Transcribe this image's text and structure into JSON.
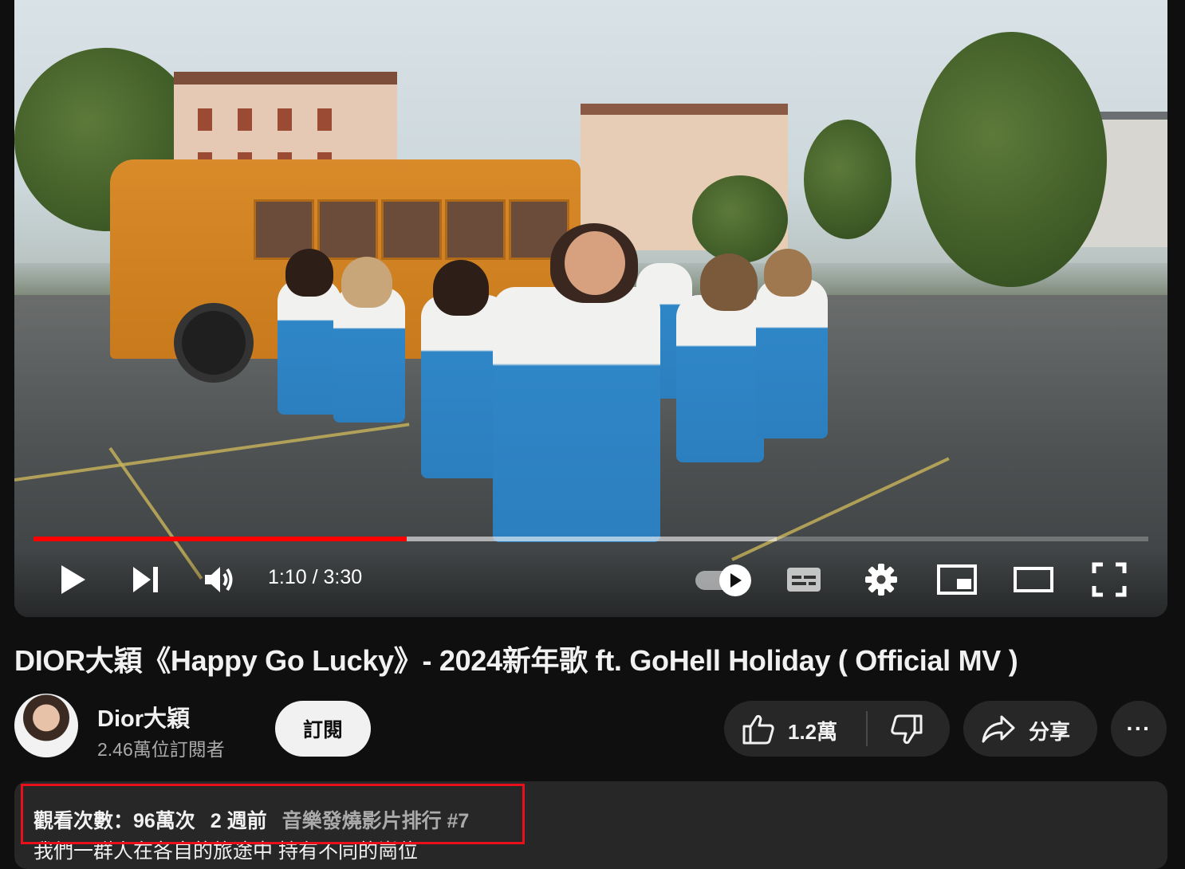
{
  "player": {
    "time_display": "1:10 / 3:30",
    "progress_played": 0.335,
    "progress_buffered": 0.667,
    "autoplay_on": true
  },
  "video": {
    "title": "DIOR大穎《Happy Go Lucky》- 2024新年歌 ft. GoHell Holiday ( Official MV )"
  },
  "channel": {
    "name": "Dior大穎",
    "subscribers": "2.46萬位訂閱者",
    "subscribe_label": "訂閱"
  },
  "actions": {
    "like_count": "1.2萬",
    "share_label": "分享",
    "more_label": "···"
  },
  "description": {
    "views": "觀看次數：96萬次",
    "date": "2 週前",
    "trending": "音樂發燒影片排行 #7",
    "first_line": "我們一群人在各自的旅途中 持有不同的崗位"
  },
  "colors": {
    "background": "#0f0f0f",
    "progress_red": "#ff0000",
    "highlight_box": "#e8111b",
    "button_bg": "#272727"
  }
}
